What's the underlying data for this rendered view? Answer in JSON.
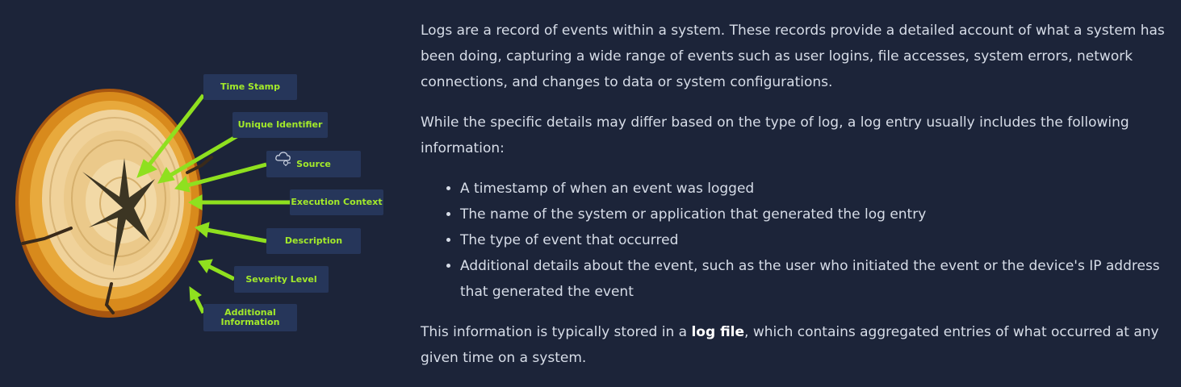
{
  "figure": {
    "labels": {
      "time_stamp": "Time Stamp",
      "unique_identifier": "Unique Identifier",
      "source": "Source",
      "execution_context": "Execution Context",
      "description": "Description",
      "severity_level": "Severity Level",
      "additional_information_line1": "Additional",
      "additional_information_line2": "Information"
    },
    "colors": {
      "background": "#1c2439",
      "label_box": "#26365a",
      "label_text": "#a3ea2a",
      "arrow": "#8fe01f",
      "wood_outer": "#c97818",
      "wood_inner": "#f1d9a4"
    },
    "icons": [
      "cloud-network-icon"
    ]
  },
  "article": {
    "para1": "Logs are a record of events within a system. These records provide a detailed account of what a system has been doing, capturing a wide range of events such as user logins, file accesses, system errors, network connections, and changes to data or system configurations.",
    "para2": "While the specific details may differ based on the type of log, a log entry usually includes the following information:",
    "bullets": [
      "A timestamp of when an event was logged",
      "The name of the system or application that generated the log entry",
      "The type of event that occurred",
      "Additional details about the event, such as the user who initiated the event or the device's IP address that generated the event"
    ],
    "para3_before": "This information is typically stored in a ",
    "para3_bold": "log file",
    "para3_after": ", which contains aggregated entries of what occurred at any given time on a system."
  }
}
